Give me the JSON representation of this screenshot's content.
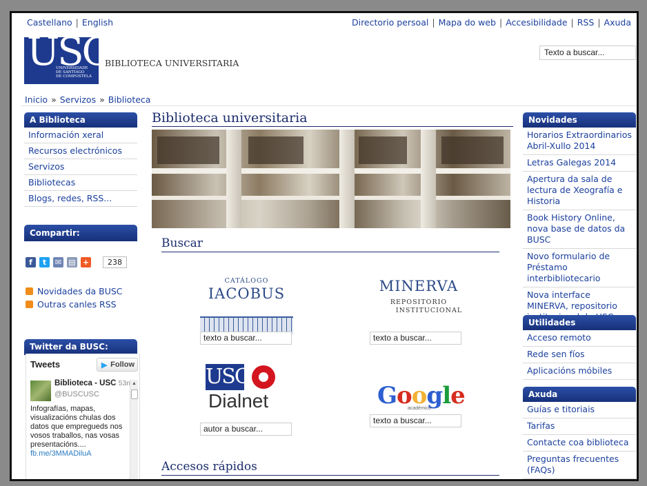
{
  "top": {
    "lang": [
      "Castellano",
      "English"
    ],
    "links": [
      "Directorio persoal",
      "Mapa do web",
      "Accesibilidade",
      "RSS",
      "Axuda"
    ]
  },
  "header": {
    "logo_text": "USC",
    "logo_small": [
      "UNIVERSIDADE",
      "DE SANTIAGO",
      "DE COMPOSTELA"
    ],
    "site_name": "BIBLIOTECA UNIVERSITARIA",
    "search_placeholder": "Texto a buscar..."
  },
  "breadcrumb": [
    "Inicio",
    "Servizos",
    "Biblioteca"
  ],
  "left": {
    "section_title": "A Biblioteca",
    "menu": [
      "Información xeral",
      "Recursos electrónicos",
      "Servizos",
      "Bibliotecas",
      "Blogs, redes, RSS..."
    ],
    "share_title": "Compartir:",
    "share_count": "238",
    "rss_links": [
      "Novidades da BUSC",
      "Outras canles RSS"
    ],
    "twitter_title": "Twitter da BUSC:",
    "tweets_label": "Tweets",
    "follow_label": "Follow",
    "tweet": {
      "name": "Biblioteca - USC",
      "time": "53m",
      "handle": "@BUSCUSC",
      "text": "Infografías, mapas, visualizacións chulas dos datos que empregueds nos vosos traballos, nas vosas presentacións....",
      "link": "fb.me/3MMADiluA"
    }
  },
  "main": {
    "title": "Biblioteca universitaria",
    "search_title": "Buscar",
    "iacobus": {
      "line1": "CATÁLOGO",
      "line2": "IACOBUS"
    },
    "minerva": {
      "line1": "MINERVA",
      "line2": "REPOSITORIO",
      "line3": "INSTITUCIONAL"
    },
    "dialnet": {
      "usc": "USC",
      "word": "Dialnet"
    },
    "google": {
      "letters": [
        "G",
        "o",
        "o",
        "g",
        "l",
        "e"
      ],
      "sub": "académico"
    },
    "inputs": [
      "texto a buscar...",
      "texto a buscar...",
      "autor a buscar...",
      "texto a buscar..."
    ],
    "quick_title": "Accesos rápidos"
  },
  "right": {
    "news_title": "Novidades",
    "news": [
      "Horarios Extraordinarios Abril-Xullo 2014",
      "Letras Galegas 2014",
      "Apertura da sala de lectura de Xeografía e Historia",
      "Book History Online, nova base de datos da BUSC",
      "Novo formulario de Préstamo interbibliotecario",
      "Nova interface MINERVA, repositorio institucional da USC"
    ],
    "util_title": "Utilidades",
    "util": [
      "Acceso remoto",
      "Rede sen fíos",
      "Aplicacións móbiles"
    ],
    "help_title": "Axuda",
    "help": [
      "Guías e titoriais",
      "Tarifas",
      "Contacte coa biblioteca",
      "Preguntas frecuentes (FAQs)"
    ]
  },
  "colors": {
    "brand_blue": "#1d3a8f",
    "link": "#1a3f9c",
    "heading": "#1b2c6b",
    "google": [
      "#2d5fd0",
      "#d62d20",
      "#f2b134",
      "#2d5fd0",
      "#1c9c3b",
      "#d62d20"
    ],
    "share": [
      "#3b5998",
      "#1da1f2",
      "#6d84b4",
      "#8a9ab8",
      "#f15a24"
    ]
  },
  "icons": {
    "share": [
      "facebook-icon",
      "twitter-icon",
      "email-icon",
      "print-icon",
      "plus-icon"
    ],
    "rss": "rss-icon",
    "twitter_bird": "twitter-bird-icon"
  }
}
